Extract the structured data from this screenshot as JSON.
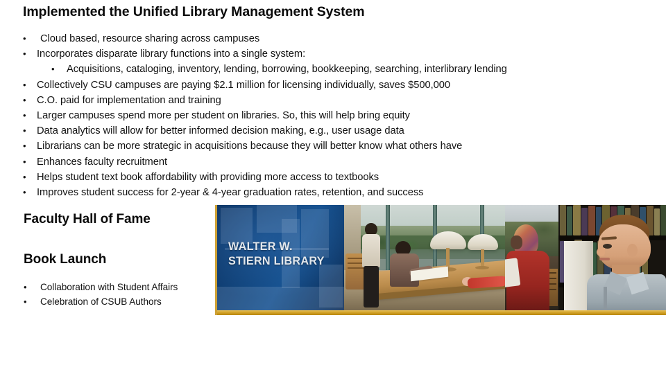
{
  "slide": {
    "title": "Implemented the Unified Library Management System",
    "bullets": [
      {
        "level": 0,
        "text": "Cloud based, resource sharing across campuses",
        "indent_variant": "wide"
      },
      {
        "level": 0,
        "text": "Incorporates disparate library functions into a single system:",
        "indent_variant": "normal"
      },
      {
        "level": 1,
        "text": "Acquisitions, cataloging, inventory, lending, borrowing, bookkeeping, searching, interlibrary lending",
        "indent_variant": "sub"
      },
      {
        "level": 0,
        "text": "Collectively CSU campuses are paying $2.1 million for licensing individually, saves $500,000",
        "indent_variant": "normal"
      },
      {
        "level": 0,
        "text": "C.O. paid for implementation and training",
        "indent_variant": "normal"
      },
      {
        "level": 0,
        "text": "Larger campuses spend more per student on libraries.  So, this will help bring equity",
        "indent_variant": "normal"
      },
      {
        "level": 0,
        "text": "Data analytics will allow for better informed decision making, e.g., user usage data",
        "indent_variant": "normal"
      },
      {
        "level": 0,
        "text": "Librarians can be more strategic in acquisitions because they will better know what others have",
        "indent_variant": "normal"
      },
      {
        "level": 0,
        "text": "Enhances faculty recruitment",
        "indent_variant": "normal"
      },
      {
        "level": 0,
        "text": "Helps student text book affordability with providing more access to textbooks",
        "indent_variant": "normal"
      },
      {
        "level": 0,
        "text": "Improves student success for 2-year & 4-year graduation rates, retention, and success",
        "indent_variant": "normal"
      }
    ],
    "bullet_marker": "•",
    "heading_faculty": "Faculty Hall of Fame",
    "heading_book": "Book Launch",
    "lower_bullets": [
      {
        "text": "Collaboration with Student Affairs"
      },
      {
        "text": "Celebration of CSUB Authors"
      }
    ]
  },
  "banner": {
    "library_name_line1": "WALTER W.",
    "library_name_line2": "STIERN LIBRARY",
    "photo_captions": {
      "panel_study": "Students studying at tables beside floor-to-ceiling windows",
      "panel_red": "Student in red with patterned hijab reading",
      "panel_shelf": "Student reaching for a book on a library shelf"
    },
    "colors": {
      "panel_blue_dark": "#0b2f5c",
      "panel_blue_light": "#15508e",
      "gold_bar": "#d2a22a",
      "library_name_text": "#e2e7ec"
    }
  }
}
